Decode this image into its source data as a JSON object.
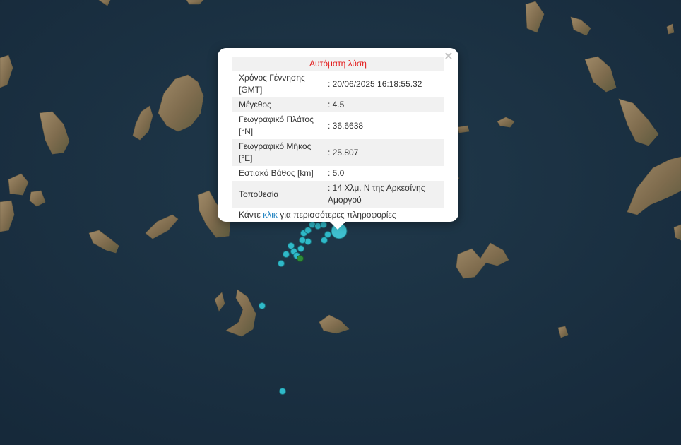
{
  "popup": {
    "title": "Αυτόματη λύση",
    "close_label": "×",
    "rows": [
      {
        "label": "Χρόνος Γέννησης [GMT]",
        "value": ": 20/06/2025 16:18:55.32"
      },
      {
        "label": "Μέγεθος",
        "value": ": 4.5"
      },
      {
        "label": "Γεωγραφικό Πλάτος [°N]",
        "value": ": 36.6638"
      },
      {
        "label": "Γεωγραφικό Μήκος [°E]",
        "value": ": 25.807"
      },
      {
        "label": "Εστιακό Βάθος [km]",
        "value": ": 5.0"
      },
      {
        "label": "Τοποθεσία",
        "value": ": 14 Χλμ. Ν της Αρκεσίνης Αμοργού"
      }
    ],
    "more_prefix": "Κάντε",
    "more_link": "κλικ",
    "more_suffix": "για περισσότερες πληροφορίες"
  },
  "colors": {
    "sea": "#1c3547",
    "land": "#8a7a5a",
    "marker_fill": "#2fb9c9",
    "marker_stroke": "#1b6f7a",
    "marker_selected": "#3fc0cf",
    "marker_green": "#2e8b3a",
    "title_red": "#e31b1b",
    "link_blue": "#1a7fbf"
  },
  "icons": {
    "close": "close-icon"
  }
}
